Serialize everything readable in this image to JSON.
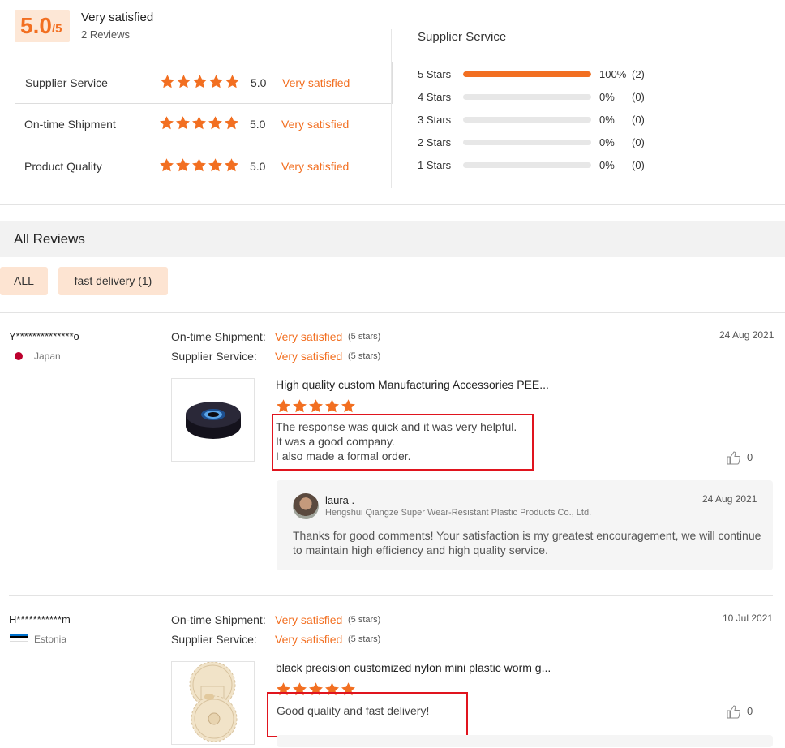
{
  "summary": {
    "score": "5.0",
    "score_suffix": "/5",
    "title": "Very satisfied",
    "count": "2 Reviews"
  },
  "ratings": [
    {
      "label": "Supplier Service",
      "value": "5.0",
      "text": "Very satisfied",
      "stars": 5
    },
    {
      "label": "On-time Shipment",
      "value": "5.0",
      "text": "Very satisfied",
      "stars": 5
    },
    {
      "label": "Product Quality",
      "value": "5.0",
      "text": "Very satisfied",
      "stars": 5
    }
  ],
  "supplier_service": {
    "title": "Supplier Service",
    "distribution": [
      {
        "label": "5 Stars",
        "percent": "100%",
        "fill": 1.0,
        "count": "(2)"
      },
      {
        "label": "4 Stars",
        "percent": "0%",
        "fill": 0,
        "count": "(0)"
      },
      {
        "label": "3 Stars",
        "percent": "0%",
        "fill": 0,
        "count": "(0)"
      },
      {
        "label": "2 Stars",
        "percent": "0%",
        "fill": 0,
        "count": "(0)"
      },
      {
        "label": "1 Stars",
        "percent": "0%",
        "fill": 0,
        "count": "(0)"
      }
    ]
  },
  "all_reviews": {
    "title": "All Reviews",
    "tags": [
      "ALL",
      "fast delivery (1)"
    ]
  },
  "reviews": [
    {
      "name": "Y**************o",
      "country": "Japan",
      "shipment_label": "On-time Shipment:",
      "shipment_value": "Very satisfied",
      "shipment_stars": "(5 stars)",
      "service_label": "Supplier Service:",
      "service_value": "Very satisfied",
      "service_stars": "(5 stars)",
      "date": "24 Aug 2021",
      "product_title": "High quality custom Manufacturing Accessories PEE...",
      "text_lines": [
        "The response was quick and it was very helpful.",
        "It was a good company.",
        "I also made a formal order."
      ],
      "likes": "0",
      "reply": {
        "name": "laura .",
        "company": "Hengshui Qiangze Super Wear-Resistant Plastic Products Co., Ltd.",
        "date": "24 Aug 2021",
        "text": "Thanks for good comments! Your satisfaction is my greatest encouragement, we will continue to maintain high efficiency and high quality service."
      }
    },
    {
      "name": "H***********m",
      "country": "Estonia",
      "shipment_label": "On-time Shipment:",
      "shipment_value": "Very satisfied",
      "shipment_stars": "(5 stars)",
      "service_label": "Supplier Service:",
      "service_value": "Very satisfied",
      "service_stars": "(5 stars)",
      "date": "10 Jul 2021",
      "product_title": "black precision customized nylon mini plastic worm g...",
      "text_lines": [
        "Good quality and fast delivery!"
      ],
      "likes": "0"
    }
  ],
  "colors": {
    "accent": "#f26f21",
    "highlight": "#e0141e"
  }
}
